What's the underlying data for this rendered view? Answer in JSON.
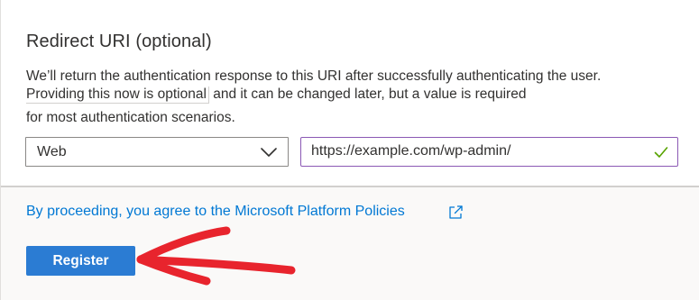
{
  "section": {
    "title": "Redirect URI (optional)",
    "description_line1": "We’ll return the authentication response to this URI after successfully authenticating the user.",
    "description_line2_highlight": "Providing this now is optional",
    "description_line2_rest": " and it can be changed later, but a value is required",
    "description_line3": "for most authentication scenarios."
  },
  "platform_select": {
    "value": "Web",
    "icon": "chevron-down-icon"
  },
  "redirect_uri": {
    "value": "https://example.com/wp-admin/",
    "valid_icon": "checkmark-icon"
  },
  "footer": {
    "policy_text": "By proceeding, you agree to the Microsoft Platform Policies",
    "policy_icon": "external-link-icon",
    "register_label": "Register"
  },
  "colors": {
    "link": "#0078d4",
    "button": "#2b7cd3",
    "annotation": "#e8242d",
    "valid_check": "#57a300",
    "input_focus": "#8b58b4"
  }
}
